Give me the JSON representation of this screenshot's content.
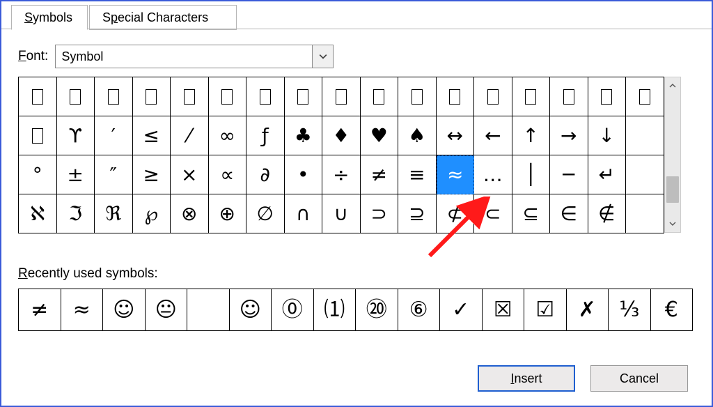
{
  "tabs": {
    "symbols_pre": "S",
    "symbols_rest": "ymbols",
    "special_pre": "S",
    "special_mid": "p",
    "special_rest": "ecial Characters"
  },
  "font": {
    "label_pre": "F",
    "label_rest": "ont:",
    "value": "Symbol"
  },
  "grid": {
    "cols": 17,
    "rows": [
      [
        "▯",
        "▯",
        "▯",
        "▯",
        "▯",
        "▯",
        "▯",
        "▯",
        "▯",
        "▯",
        "▯",
        "▯",
        "▯",
        "▯",
        "▯",
        "▯",
        "▯"
      ],
      [
        "▯",
        "ϒ",
        "′",
        "≤",
        "⁄",
        "∞",
        "ƒ",
        "♣",
        "♦",
        "♥",
        "♠",
        "↔",
        "←",
        "↑",
        "→",
        "↓",
        ""
      ],
      [
        "°",
        "±",
        "″",
        "≥",
        "×",
        "∝",
        "∂",
        "•",
        "÷",
        "≠",
        "≡",
        "≈",
        "…",
        "│",
        "─",
        "↵",
        ""
      ],
      [
        "ℵ",
        "ℑ",
        "ℜ",
        "℘",
        "⊗",
        "⊕",
        "∅",
        "∩",
        "∪",
        "⊃",
        "⊇",
        "⊄",
        "⊂",
        "⊆",
        "∈",
        "∉",
        ""
      ]
    ],
    "selected": {
      "row": 2,
      "col": 11
    }
  },
  "recent": {
    "label_pre": "R",
    "label_rest": "ecently used symbols:",
    "cells": [
      "≠",
      "≈",
      "☺",
      "😐",
      "",
      "☺",
      "⓪",
      "⑴",
      "⑳",
      "⑥",
      "✓",
      "☒",
      "☑",
      "✗",
      "⅓",
      "€"
    ]
  },
  "buttons": {
    "insert_pre": "I",
    "insert_rest": "nsert",
    "cancel": "Cancel"
  }
}
